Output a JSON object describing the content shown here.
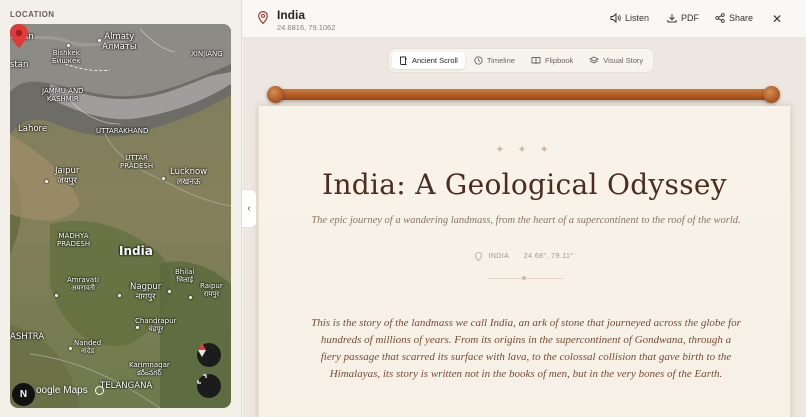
{
  "left_panel": {
    "section_label": "LOCATION",
    "map": {
      "labels": [
        {
          "text": "Almaty\nАлматы"
        },
        {
          "text": "hstan"
        },
        {
          "text": "Bishkek\nБишкек"
        },
        {
          "text": "stan"
        },
        {
          "text": "XINJIANG"
        },
        {
          "text": "JAMMU AND\nKASHMIR"
        },
        {
          "text": "Lahore"
        },
        {
          "text": "UTTARAKHAND"
        },
        {
          "text": "UTTAR\nPRADESH"
        },
        {
          "text": "Jaipur\nजयपुर"
        },
        {
          "text": "Lucknow\nलखनऊ"
        },
        {
          "text": "MADHYA\nPRADESH"
        },
        {
          "text": "India"
        },
        {
          "text": "Amravati\nअमरावती"
        },
        {
          "text": "Bhilai\nभिलाई"
        },
        {
          "text": "Nagpur\nनागपुर"
        },
        {
          "text": "Raipur\nरायपुर"
        },
        {
          "text": "ASHTRA"
        },
        {
          "text": "Chandrapur\nचंद्रपूर"
        },
        {
          "text": "Nanded\nनांदेड"
        },
        {
          "text": "Karimnagar\nకరీంనగర్"
        },
        {
          "text": "TELANGANA"
        }
      ],
      "attribution": "oogle Maps",
      "compass_label": "N"
    }
  },
  "header": {
    "title": "India",
    "coords": "24.6816, 79.1062",
    "actions": {
      "listen": "Listen",
      "pdf": "PDF",
      "share": "Share"
    },
    "close_glyph": "✕"
  },
  "view_tabs": [
    {
      "label": "Ancient Scroll",
      "icon": "scroll-icon",
      "active": true
    },
    {
      "label": "Timeline",
      "icon": "clock-icon",
      "active": false
    },
    {
      "label": "Flipbook",
      "icon": "book-icon",
      "active": false
    },
    {
      "label": "Visual Story",
      "icon": "layers-icon",
      "active": false
    }
  ],
  "scroll": {
    "ornament": "✦ ✦ ✦",
    "heading": "India: A Geological Odyssey",
    "subtitle": "The epic journey of a wandering landmass, from the heart of a supercontinent to the roof of the world.",
    "meta_place": "INDIA",
    "meta_sep": "·",
    "meta_coords": "24.68°, 79.11°",
    "body": "This is the story of the landmass we call India, an ark of stone that journeyed across the globe for hundreds of millions of years. From its origins in the supercontinent of Gondwana, through a fiery passage that scarred its surface with lava, to the colossal collision that gave birth to the Himalayas, its story is written not in the books of men, but in the very bones of the Earth."
  },
  "colors": {
    "accent": "#8e3f12",
    "heading": "#4b2d20",
    "pin": "#e03a3a"
  }
}
